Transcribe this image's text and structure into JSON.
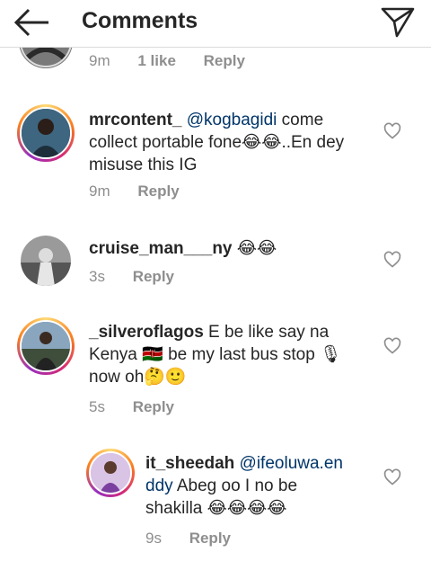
{
  "header": {
    "title": "Comments"
  },
  "top_partial": {
    "time": "9m",
    "likes": "1 like",
    "reply_label": "Reply"
  },
  "comments": [
    {
      "username": "mrcontent_",
      "mention": "@kogbagidi",
      "text": " come collect portable fone😂😂..En dey misuse this IG",
      "time": "9m",
      "reply_label": "Reply"
    },
    {
      "username": "cruise_man___ny",
      "mention": "",
      "text": " 😂😂",
      "time": "3s",
      "reply_label": "Reply"
    },
    {
      "username": "_silveroflagos",
      "mention": "",
      "text": " E be like say na Kenya 🇰🇪 be my last bus stop 🎙 now oh🤔🙂",
      "time": "5s",
      "reply_label": "Reply"
    },
    {
      "username": "it_sheedah",
      "mention": "@ifeoluwa.enddy",
      "text": " Abeg oo I no be shakilla 😂😂😂😂",
      "time": "9s",
      "reply_label": "Reply"
    }
  ]
}
